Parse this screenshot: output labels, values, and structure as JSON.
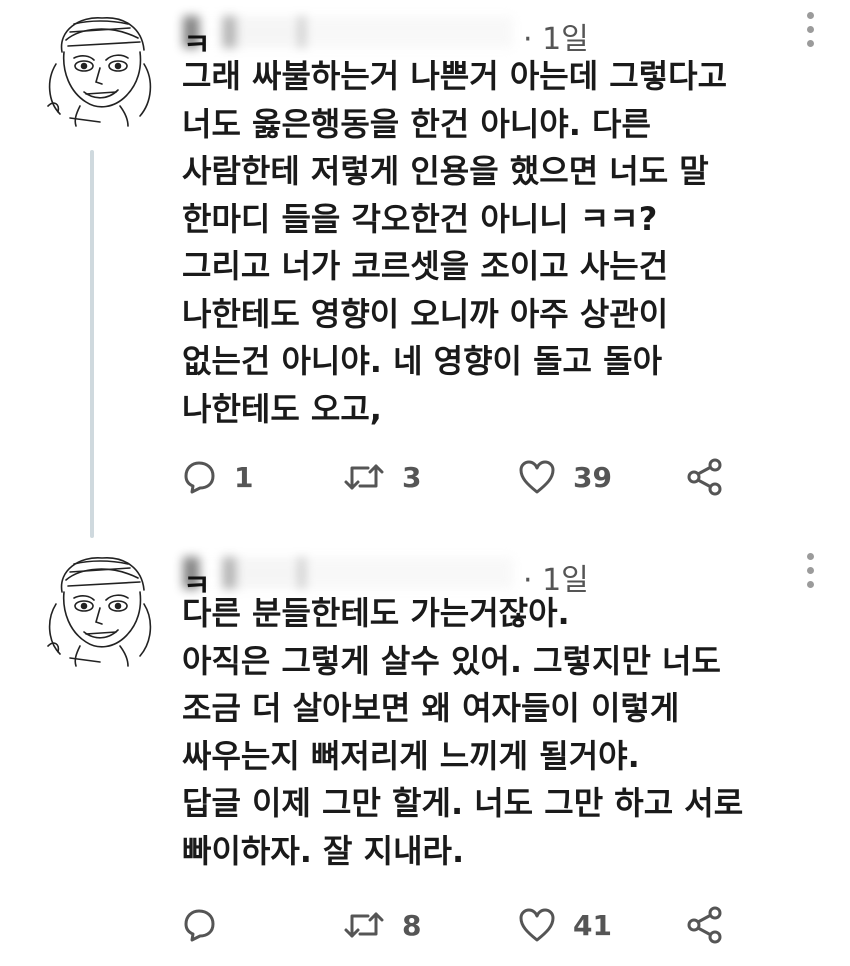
{
  "tweets": [
    {
      "author_name": "ㅋ",
      "timestamp": "· 1일",
      "text": "그래 싸불하는거 나쁜거 아는데 그렇다고\n너도 옳은행동을 한건 아니야. 다른\n사람한테 저렇게 인용을 했으면 너도 말\n한마디 들을 각오한건 아니니 ㅋㅋ?\n그리고 너가 코르셋을 조이고 사는건\n나한테도 영향이 오니까 아주 상관이\n없는건 아니야. 네 영향이 돌고 돌아\n나한테도 오고,",
      "reply_count": "1",
      "retweet_count": "3",
      "like_count": "39"
    },
    {
      "author_name": "ㅋ",
      "timestamp": "· 1일",
      "text": "다른 분들한테도 가는거잖아.\n아직은 그렇게 살수 있어. 그렇지만 너도\n조금 더 살아보면 왜 여자들이 이렇게\n싸우는지 뼈저리게 느끼게 될거야.\n답글 이제 그만 할게. 너도 그만 하고 서로\n빠이하자. 잘 지내라.",
      "reply_count": "",
      "retweet_count": "8",
      "like_count": "41"
    }
  ],
  "icons": {
    "reply": "reply-bubble-icon",
    "retweet": "retweet-arrows-icon",
    "like": "heart-icon",
    "share": "share-nodes-icon",
    "more": "vertical-dots-icon"
  },
  "colors": {
    "icon_gray": "#555555",
    "thread_line": "#cfd9de",
    "text": "#1a1a1a"
  }
}
